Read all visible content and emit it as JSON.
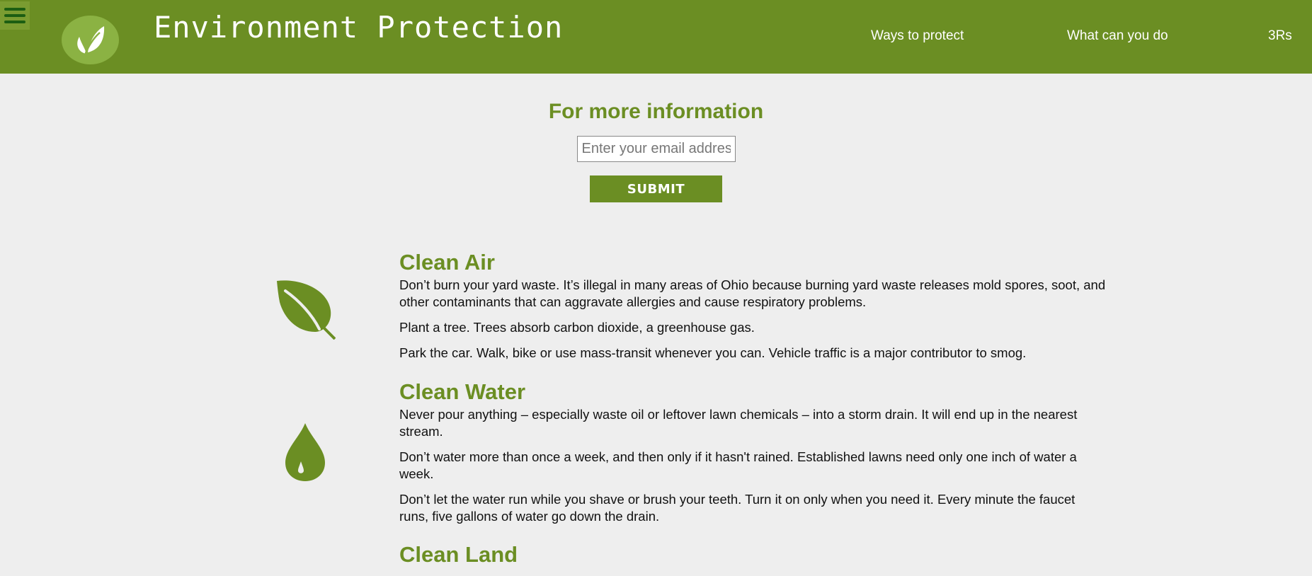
{
  "header": {
    "title": "Environment Protection",
    "menu_icon": "hamburger-menu-icon",
    "logo_icon": "leaf-logo-icon",
    "nav": [
      {
        "label": "Ways to protect"
      },
      {
        "label": "What can you do"
      },
      {
        "label": "3Rs"
      }
    ]
  },
  "signup": {
    "title": "For more information",
    "email_placeholder": "Enter your email address",
    "submit_label": "SUBMIT"
  },
  "sections": [
    {
      "title": "Clean Air",
      "icon": "leaf-icon",
      "paragraphs": [
        "Don’t burn your yard waste. It’s illegal in many areas of Ohio because burning yard waste releases mold spores, soot, and other contaminants that can aggravate allergies and cause respiratory problems.",
        "Plant a tree. Trees absorb carbon dioxide, a greenhouse gas.",
        "Park the car. Walk, bike or use mass-transit whenever you can. Vehicle traffic is a major contributor to smog."
      ]
    },
    {
      "title": "Clean Water",
      "icon": "water-drop-icon",
      "paragraphs": [
        "Never pour anything – especially waste oil or leftover lawn chemicals – into a storm drain. It will end up in the nearest stream.",
        "Don’t water more than once a week, and then only if it hasn't rained. Established lawns need only one inch of water a week.",
        "Don’t let the water run while you shave or brush your teeth. Turn it on only when you need it. Every minute the faucet runs, five gallons of water go down the drain."
      ]
    },
    {
      "title": "Clean Land",
      "paragraphs": []
    }
  ],
  "colors": {
    "brand_green": "#6b8e23",
    "logo_circle": "#8bb243",
    "page_background": "#eeeeee"
  }
}
